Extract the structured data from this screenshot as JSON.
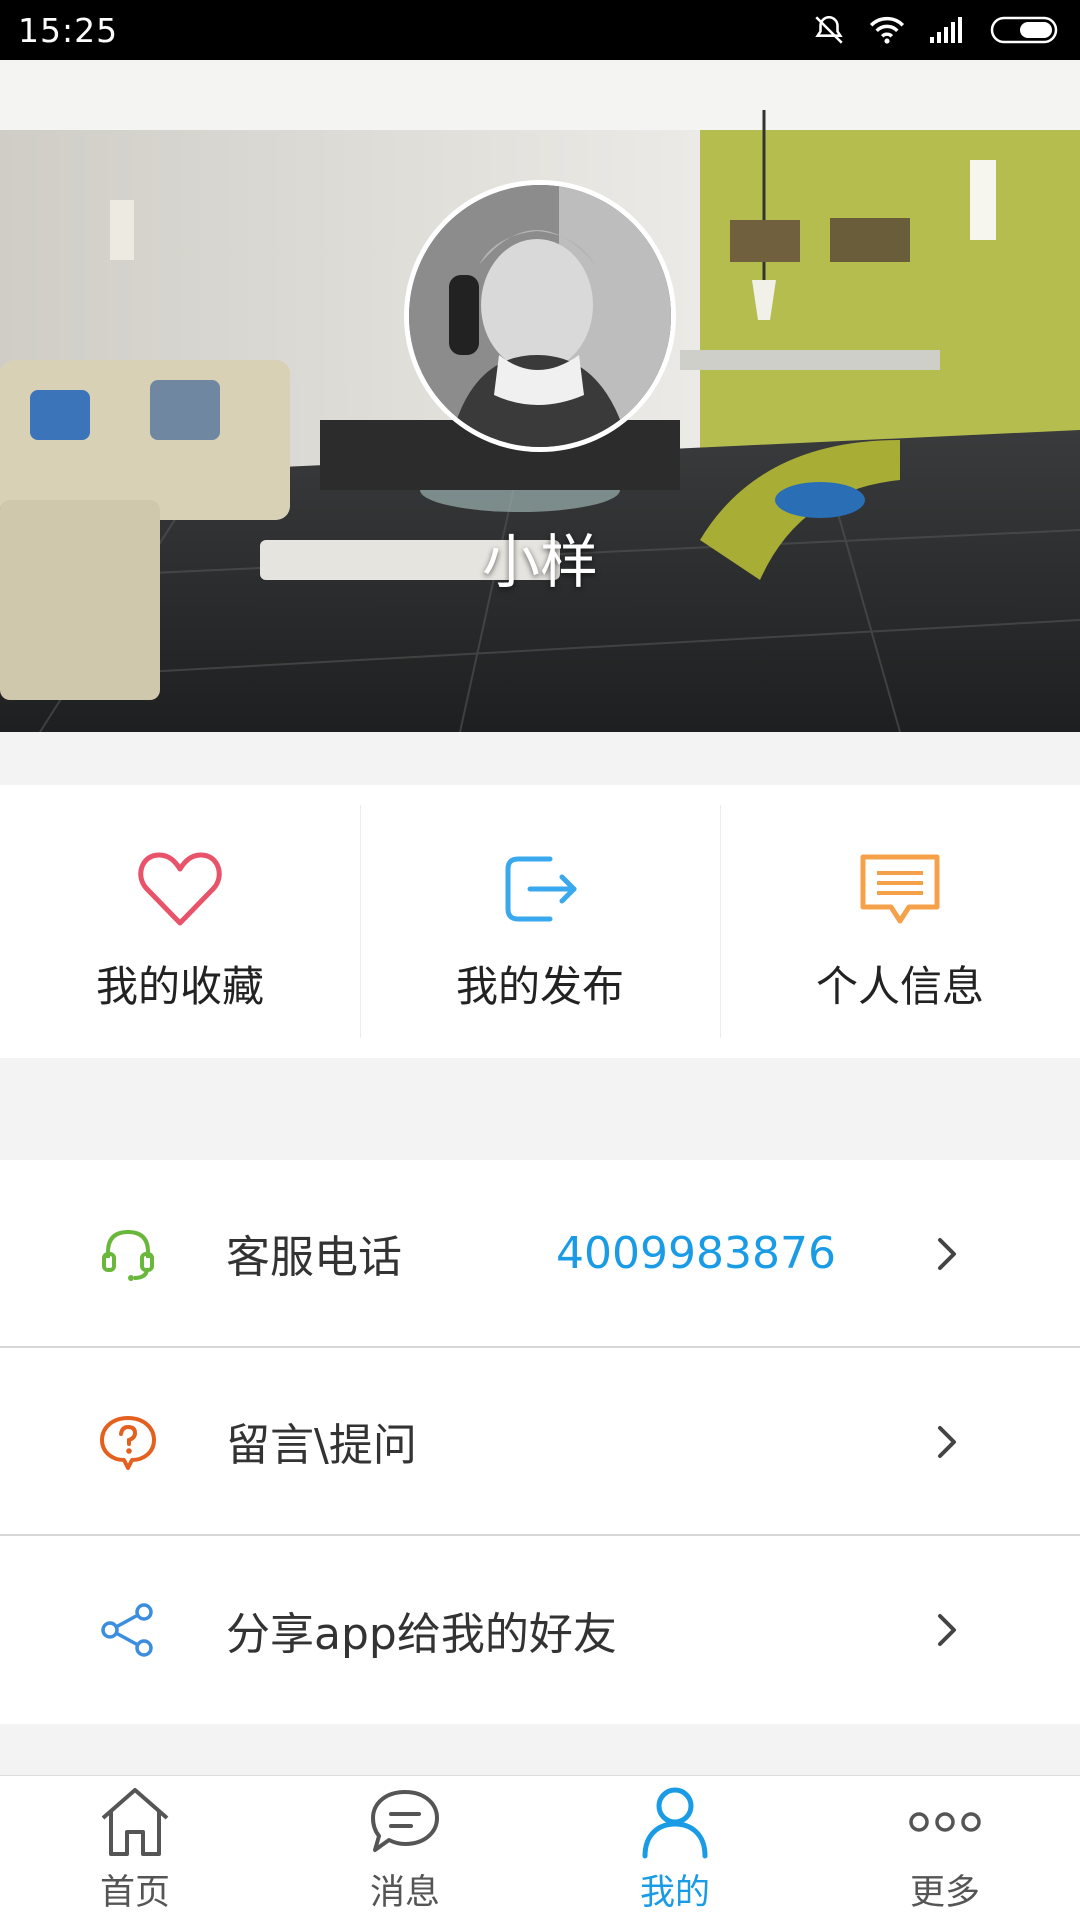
{
  "status_bar": {
    "time": "15:25",
    "icons": [
      "bell-off-icon",
      "wifi-icon",
      "signal-icon",
      "battery-icon"
    ]
  },
  "profile": {
    "username": "小样",
    "avatar_icon": "avatar-photo"
  },
  "quick_actions": [
    {
      "label": "我的收藏",
      "icon": "heart-icon",
      "color": "#e9536a"
    },
    {
      "label": "我的发布",
      "icon": "publish-icon",
      "color": "#3aa8ee"
    },
    {
      "label": "个人信息",
      "icon": "message-card-icon",
      "color": "#f5a14a"
    }
  ],
  "list": [
    {
      "label": "客服电话",
      "value": "4009983876",
      "icon": "headset-icon",
      "icon_color": "#6ab83b"
    },
    {
      "label": "留言\\提问",
      "value": "",
      "icon": "question-bubble-icon",
      "icon_color": "#e4601f"
    },
    {
      "label": "分享app给我的好友",
      "value": "",
      "icon": "share-icon",
      "icon_color": "#3b8de0"
    }
  ],
  "bottom_nav": {
    "active": "我的",
    "items": [
      {
        "label": "首页",
        "icon": "home-icon"
      },
      {
        "label": "消息",
        "icon": "chat-icon"
      },
      {
        "label": "我的",
        "icon": "user-icon"
      },
      {
        "label": "更多",
        "icon": "more-icon"
      }
    ]
  },
  "colors": {
    "accent": "#1a9be6",
    "background": "#f3f3f3"
  }
}
